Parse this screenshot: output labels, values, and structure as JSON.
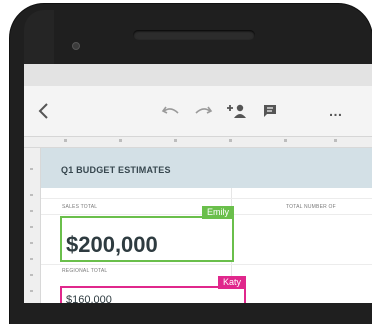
{
  "toolbar": {
    "icons": [
      "back-icon",
      "undo-icon",
      "redo-icon",
      "add-user-icon",
      "comment-icon",
      "more-icon"
    ],
    "more_label": "…"
  },
  "sheet": {
    "title": "Q1 BUDGET ESTIMATES",
    "sales_label": "SALES TOTAL",
    "total_number_label": "TOTAL NUMBER OF",
    "sales_value": "$200,000",
    "regional_label": "REGIONAL TOTAL",
    "regional_value": "$160,000"
  },
  "collaborators": {
    "emily": {
      "name": "Emily",
      "color": "#6abf4b"
    },
    "katy": {
      "name": "Katy",
      "color": "#e0278c"
    }
  }
}
